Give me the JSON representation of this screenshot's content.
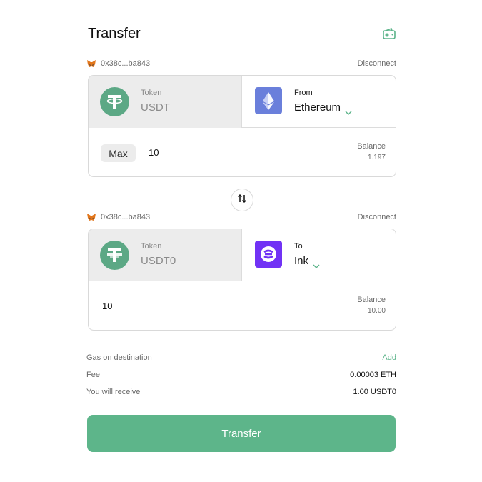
{
  "header": {
    "title": "Transfer",
    "wallet_icon": "wallet-plus-icon"
  },
  "source": {
    "account": {
      "icon": "metamask-fox-icon",
      "address": "0x38c...ba843",
      "disconnect_label": "Disconnect"
    },
    "token": {
      "label": "Token",
      "symbol": "USDT",
      "icon": "tether-icon"
    },
    "network": {
      "label": "From",
      "name": "Ethereum",
      "icon": "ethereum-icon"
    },
    "max_label": "Max",
    "amount": "10",
    "balance_label": "Balance",
    "balance_value": "1.197"
  },
  "swap_icon": "swap-arrows-icon",
  "destination": {
    "account": {
      "icon": "metamask-fox-icon",
      "address": "0x38c...ba843",
      "disconnect_label": "Disconnect"
    },
    "token": {
      "label": "Token",
      "symbol": "USDT0",
      "icon": "tether-icon"
    },
    "network": {
      "label": "To",
      "name": "Ink",
      "icon": "ink-icon"
    },
    "amount": "10",
    "balance_label": "Balance",
    "balance_value": "10.00"
  },
  "summary": {
    "gas": {
      "label": "Gas on destination",
      "value": "Add"
    },
    "fee": {
      "label": "Fee",
      "value": "0.00003 ETH"
    },
    "receive": {
      "label": "You will receive",
      "value": "1.00 USDT0"
    }
  },
  "transfer_button": "Transfer",
  "colors": {
    "accent": "#5db58a",
    "token_bg": "#5ca885",
    "ethereum": "#6a7fdb",
    "ink": "#7132f5",
    "card_border": "#d9d9d9",
    "panel_gray": "#ececec"
  }
}
